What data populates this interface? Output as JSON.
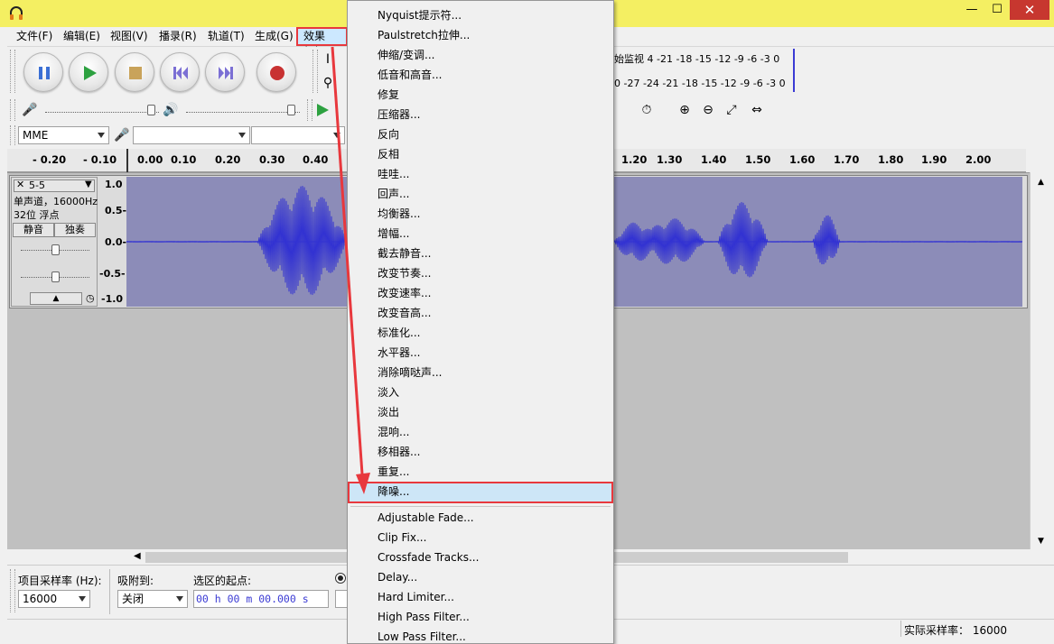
{
  "menubar": {
    "items": [
      "文件(F)",
      "编辑(E)",
      "视图(V)",
      "播录(R)",
      "轨道(T)",
      "生成(G)",
      "效果(C)"
    ]
  },
  "device": {
    "host": "MME"
  },
  "meters": {
    "record": "始监视 4 -21 -18 -15 -12 -9 -6 -3 0",
    "play": "0 -27 -24 -21 -18 -15 -12 -9 -6 -3 0"
  },
  "ruler": {
    "ticks": [
      "- 0.20",
      "- 0.10",
      "0.00",
      "0.10",
      "0.20",
      "0.30",
      "0.40",
      "1.20",
      "1.30",
      "1.40",
      "1.50",
      "1.60",
      "1.70",
      "1.80",
      "1.90",
      "2.00"
    ]
  },
  "track": {
    "name": "5-5",
    "info1": "单声道，16000Hz",
    "info2": "32位 浮点",
    "mute": "静音",
    "solo": "独奏",
    "scale": [
      "1.0",
      "0.5-",
      "0.0-",
      "-0.5-",
      "-1.0"
    ]
  },
  "selection": {
    "rate_label": "项目采样率 (Hz):",
    "rate_value": "16000",
    "snap_label": "吸附到:",
    "snap_value": "关闭",
    "start_label": "选区的起点:",
    "start_value": "00 h 00 m 00.000 s"
  },
  "status": {
    "actual_rate": "实际采样率： 16000"
  },
  "effects_menu": {
    "items": [
      "Nyquist提示符...",
      "Paulstretch拉伸...",
      "伸缩/变调...",
      "低音和高音...",
      "修复",
      "压缩器...",
      "反向",
      "反相",
      "哇哇...",
      "回声...",
      "均衡器...",
      "增幅...",
      "截去静音...",
      "改变节奏...",
      "改变速率...",
      "改变音高...",
      "标准化...",
      "水平器...",
      "消除嘀哒声...",
      "淡入",
      "淡出",
      "混响...",
      "移相器...",
      "重复...",
      "降噪..."
    ],
    "plugins": [
      "Adjustable Fade...",
      "Clip Fix...",
      "Crossfade Tracks...",
      "Delay...",
      "Hard Limiter...",
      "High Pass Filter...",
      "Low Pass Filter..."
    ],
    "highlight_color": "#e8383d"
  }
}
